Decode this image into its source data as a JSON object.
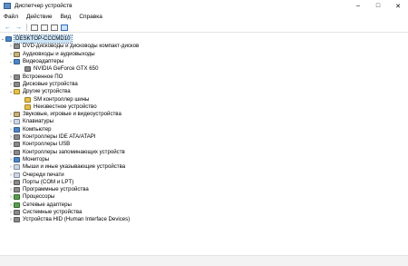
{
  "window": {
    "title": "Диспетчер устройств",
    "minimize": "–",
    "maximize": "□",
    "close": "✕"
  },
  "menu": [
    "Файл",
    "Действие",
    "Вид",
    "Справка"
  ],
  "toolbar": {
    "back": "←",
    "forward": "→"
  },
  "tree": {
    "root": "DESKTOP-CCCMD10",
    "items": [
      {
        "label": "DVD-дисководы и дисководы компакт-дисков",
        "level": 1,
        "chevron": "›",
        "icon": "dvd-drive-icon"
      },
      {
        "label": "Аудиовходы и аудиовыходы",
        "level": 1,
        "chevron": "›",
        "icon": "audio-io-icon"
      },
      {
        "label": "Видеоадаптеры",
        "level": 1,
        "chevron": "⌄",
        "icon": "display-adapter-icon"
      },
      {
        "label": "NVIDIA GeForce GTX 650",
        "level": 2,
        "chevron": "",
        "icon": "gpu-icon"
      },
      {
        "label": "Встроенное ПО",
        "level": 1,
        "chevron": "›",
        "icon": "firmware-icon"
      },
      {
        "label": "Дисковые устройства",
        "level": 1,
        "chevron": "›",
        "icon": "disk-drive-icon"
      },
      {
        "label": "Другие устройства",
        "level": 1,
        "chevron": "⌄",
        "icon": "other-devices-icon"
      },
      {
        "label": "SM контроллер шины",
        "level": 2,
        "chevron": "",
        "icon": "unknown-device-warning-icon"
      },
      {
        "label": "Неизвестное устройство",
        "level": 2,
        "chevron": "",
        "icon": "unknown-device-warning-icon"
      },
      {
        "label": "Звуковые, игровые и видеоустройства",
        "level": 1,
        "chevron": "›",
        "icon": "sound-icon"
      },
      {
        "label": "Клавиатуры",
        "level": 1,
        "chevron": "›",
        "icon": "keyboard-icon"
      },
      {
        "label": "Компьютер",
        "level": 1,
        "chevron": "›",
        "icon": "computer-icon"
      },
      {
        "label": "Контроллеры IDE ATA/ATAPI",
        "level": 1,
        "chevron": "›",
        "icon": "ide-controller-icon"
      },
      {
        "label": "Контроллеры USB",
        "level": 1,
        "chevron": "›",
        "icon": "usb-icon"
      },
      {
        "label": "Контроллеры запоминающих устройств",
        "level": 1,
        "chevron": "›",
        "icon": "storage-controller-icon"
      },
      {
        "label": "Мониторы",
        "level": 1,
        "chevron": "›",
        "icon": "monitor-icon"
      },
      {
        "label": "Мыши и иные указывающие устройства",
        "level": 1,
        "chevron": "›",
        "icon": "mouse-icon"
      },
      {
        "label": "Очереди печати",
        "level": 1,
        "chevron": "›",
        "icon": "print-queue-icon"
      },
      {
        "label": "Порты (COM и LPT)",
        "level": 1,
        "chevron": "›",
        "icon": "port-icon"
      },
      {
        "label": "Программные устройства",
        "level": 1,
        "chevron": "›",
        "icon": "software-device-icon"
      },
      {
        "label": "Процессоры",
        "level": 1,
        "chevron": "›",
        "icon": "processor-icon"
      },
      {
        "label": "Сетевые адаптеры",
        "level": 1,
        "chevron": "›",
        "icon": "network-adapter-icon"
      },
      {
        "label": "Системные устройства",
        "level": 1,
        "chevron": "›",
        "icon": "system-device-icon"
      },
      {
        "label": "Устройства HID (Human Interface Devices)",
        "level": 1,
        "chevron": "›",
        "icon": "hid-icon"
      }
    ]
  }
}
